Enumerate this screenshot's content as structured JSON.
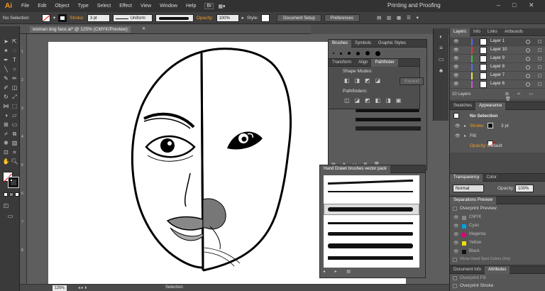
{
  "menubar": {
    "logo": "Ai",
    "items": [
      "File",
      "Edit",
      "Object",
      "Type",
      "Select",
      "Effect",
      "View",
      "Window",
      "Help"
    ],
    "workspace": "Printing and Proofing"
  },
  "control": {
    "selection": "No Selection",
    "stroke_label": "Stroke:",
    "stroke_weight": "3 pt",
    "uniform": "Uniform",
    "opacity_label": "Opacity:",
    "opacity_value": "100%",
    "style_label": "Style:",
    "doc_setup": "Document Setup",
    "preferences": "Preferences"
  },
  "document": {
    "tab": "woman dog face.ai* @ 125% (CMYK/Preview)"
  },
  "rulers": {
    "left": [
      "1",
      "2",
      "3",
      "4",
      "5",
      "6",
      "7",
      "8"
    ]
  },
  "status": {
    "zoom": "125%",
    "tool": "Selection"
  },
  "brushes_panel": {
    "tabs": [
      "Brushes",
      "Symbols",
      "Graphic Styles"
    ]
  },
  "pathfinder_panel": {
    "tabs": [
      "Transform",
      "Align",
      "Pathfinder"
    ],
    "shape_modes": "Shape Modes:",
    "expand": "Expand",
    "pathfinders": "Pathfinders:"
  },
  "hand_panel": {
    "title": "Hand Drawn brushes vector pack"
  },
  "layers_panel": {
    "tabs": [
      "Layers",
      "Info",
      "Links",
      "Artboards"
    ],
    "layers": [
      {
        "name": "Layer 1",
        "color": "#4f6ef7"
      },
      {
        "name": "Layer 10",
        "color": "#e53a3a"
      },
      {
        "name": "Layer 9",
        "color": "#3ac53a"
      },
      {
        "name": "Layer 8",
        "color": "#4f6ef7"
      },
      {
        "name": "Layer 7",
        "color": "#f0e03a"
      },
      {
        "name": "Layer 6",
        "color": "#d64fd6"
      }
    ],
    "count": "10 Layers"
  },
  "appearance_panel": {
    "tabs": [
      "Swatches",
      "Appearance"
    ],
    "title": "No Selection",
    "stroke": "Stroke:",
    "stroke_val": "3 pt",
    "fill": "Fill:",
    "opacity": "Opacity:",
    "opacity_val": "Default"
  },
  "transparency_panel": {
    "tabs": [
      "Transparency",
      "Color"
    ],
    "mode": "Normal",
    "opacity": "Opacity:",
    "opacity_val": "100%"
  },
  "separations_panel": {
    "title": "Separations Preview",
    "overprint": "Overprint Preview",
    "inks": [
      {
        "name": "CMYK",
        "color": "#888888"
      },
      {
        "name": "Cyan",
        "color": "#00a0e0"
      },
      {
        "name": "Magenta",
        "color": "#e0007a"
      },
      {
        "name": "Yellow",
        "color": "#f0e000"
      },
      {
        "name": "Black",
        "color": "#111111"
      }
    ],
    "spot": "Show Used Spot Colors Only"
  },
  "attributes_panel": {
    "tabs": [
      "Document Info",
      "Attributes"
    ],
    "overprint_fill": "Overprint Fill",
    "overprint_stroke": "Overprint Stroke"
  }
}
